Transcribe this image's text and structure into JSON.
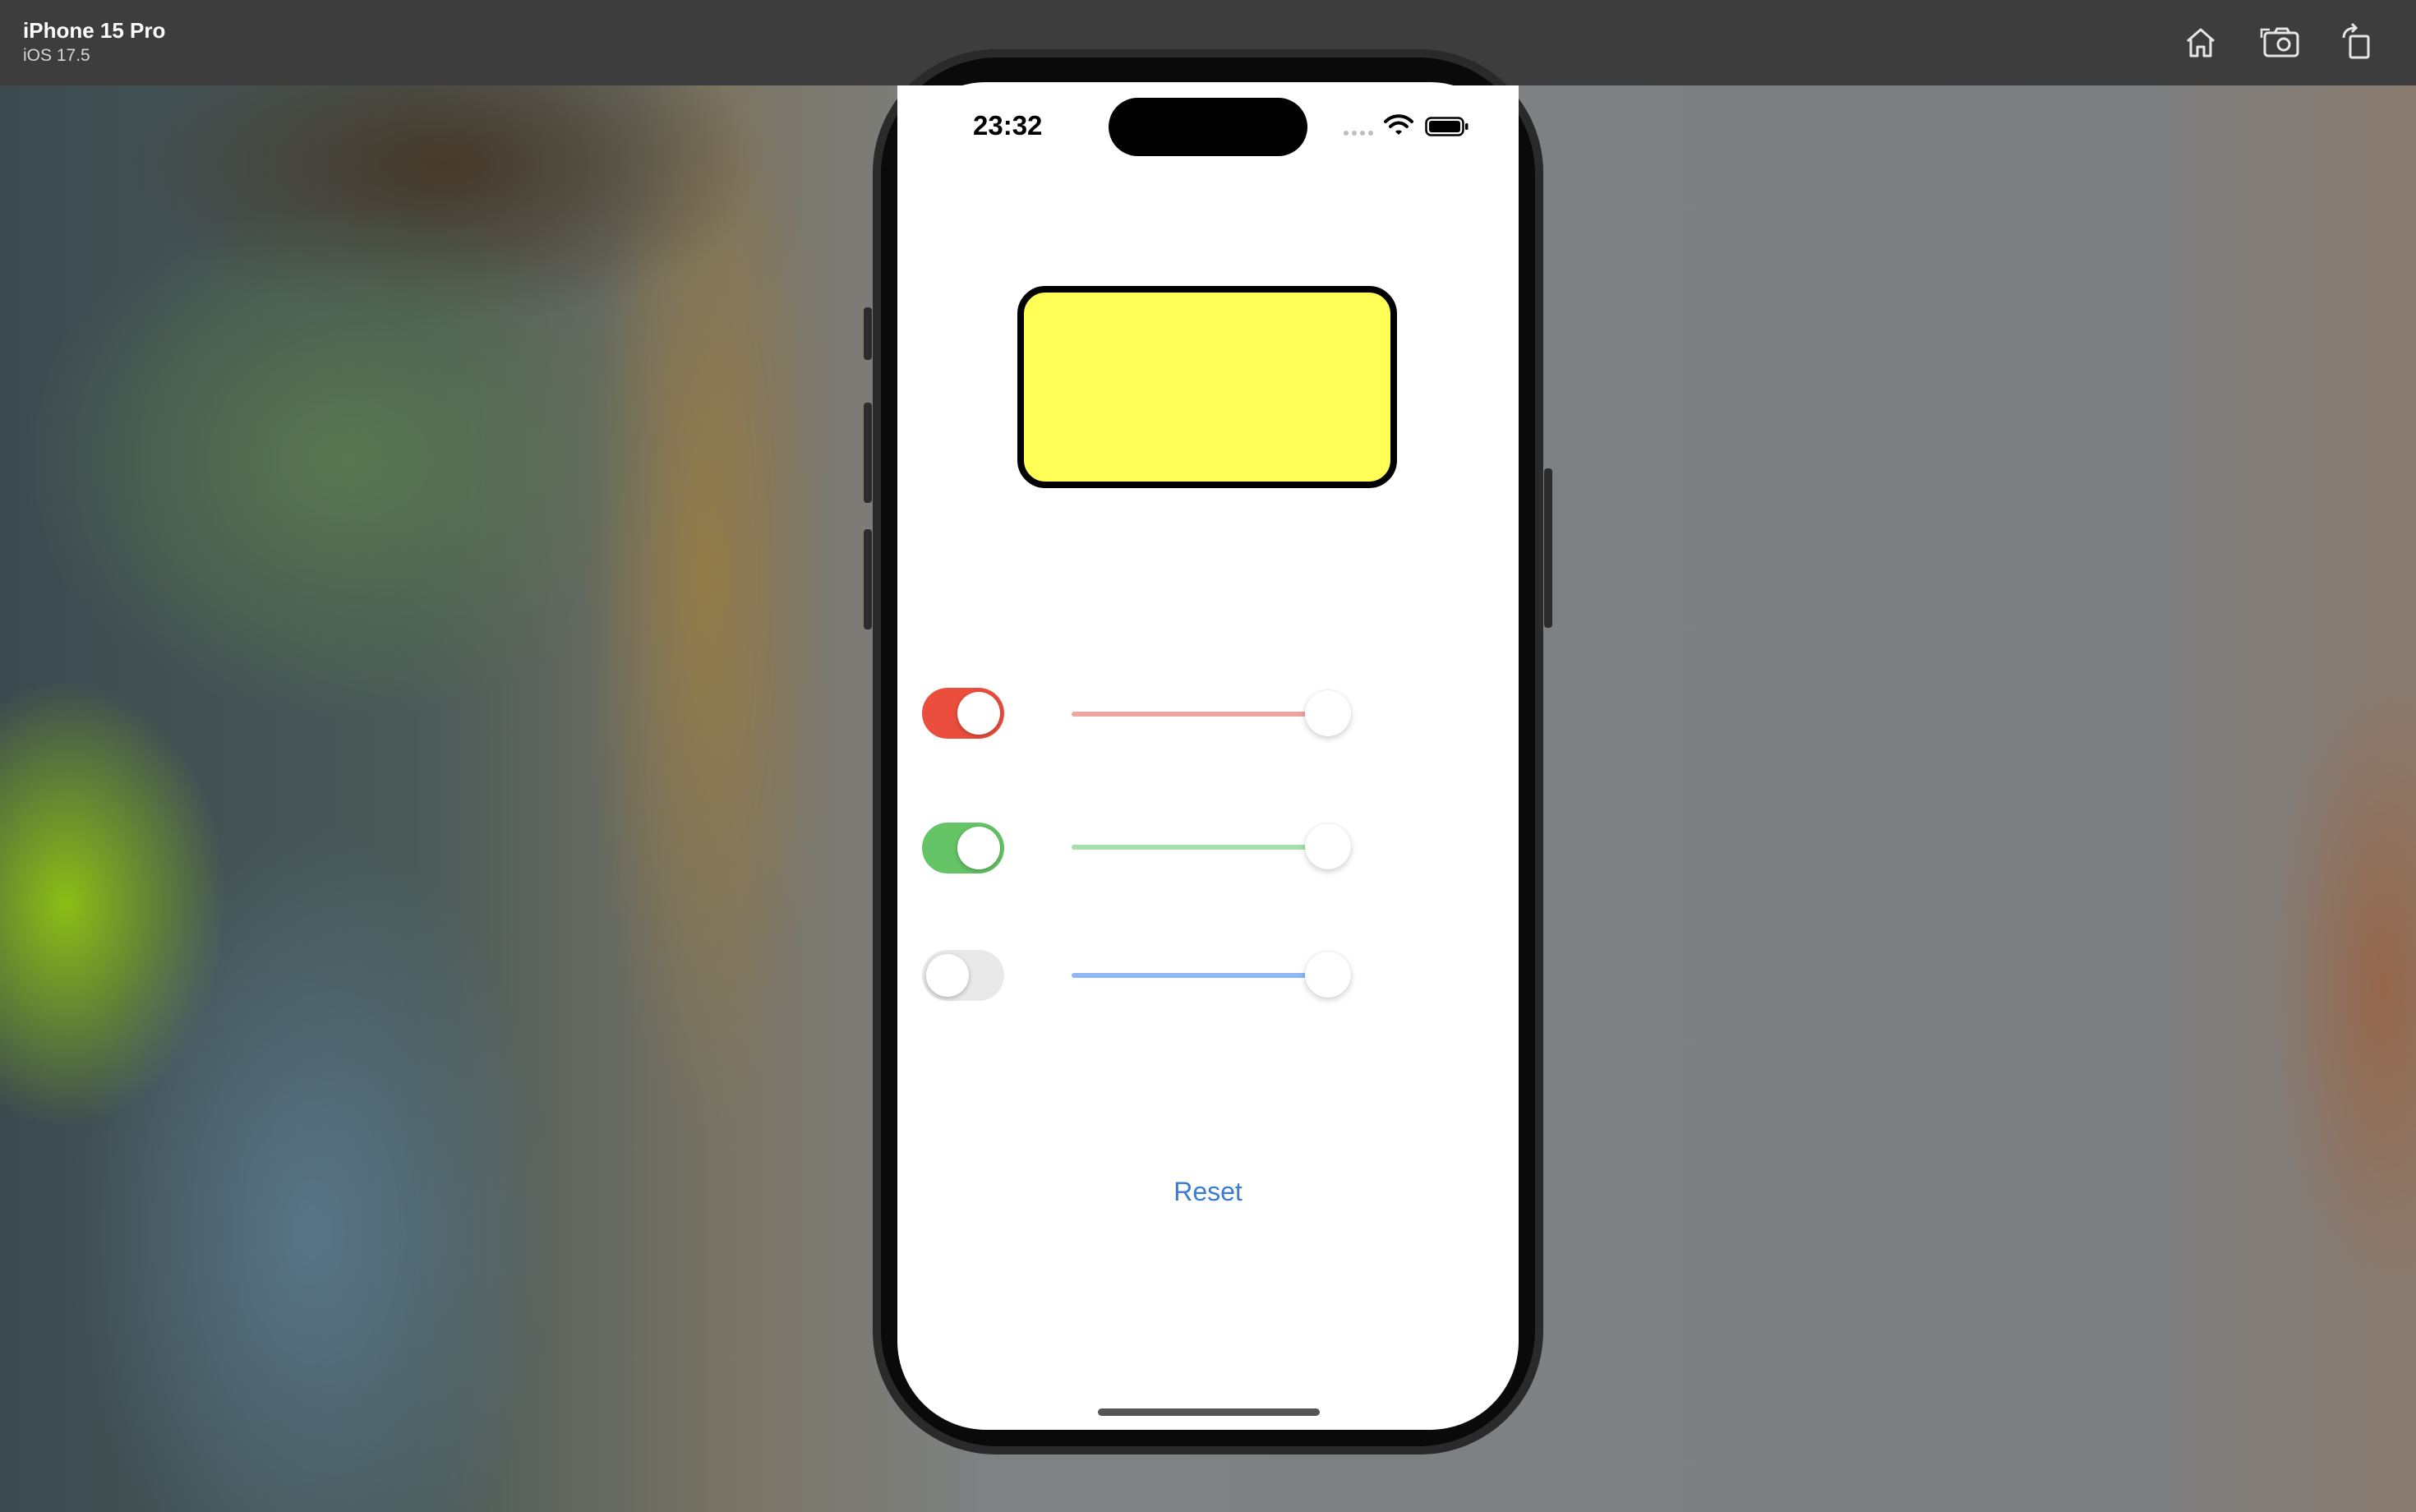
{
  "simulator": {
    "device_name": "iPhone 15 Pro",
    "os_version": "iOS 17.5",
    "toolbar_icons": [
      "home-icon",
      "screenshot-icon",
      "rotate-icon"
    ]
  },
  "status_bar": {
    "time": "23:32",
    "icons": [
      "signal-icon",
      "wifi-icon",
      "battery-icon"
    ]
  },
  "preview": {
    "fill_color": "#ffff57",
    "border_color": "#000000"
  },
  "controls": [
    {
      "channel": "red",
      "toggle_on": true,
      "toggle_color": "#eb4e3d",
      "slider_value": 1.0,
      "track_color": "#eea59f"
    },
    {
      "channel": "green",
      "toggle_on": true,
      "toggle_color": "#65c466",
      "slider_value": 1.0,
      "track_color": "#a8deab"
    },
    {
      "channel": "blue",
      "toggle_on": false,
      "toggle_color": "#e9e9ea",
      "slider_value": 1.0,
      "track_color": "#8fb8f0"
    }
  ],
  "reset_button": {
    "label": "Reset",
    "color": "#3a7bd5"
  }
}
